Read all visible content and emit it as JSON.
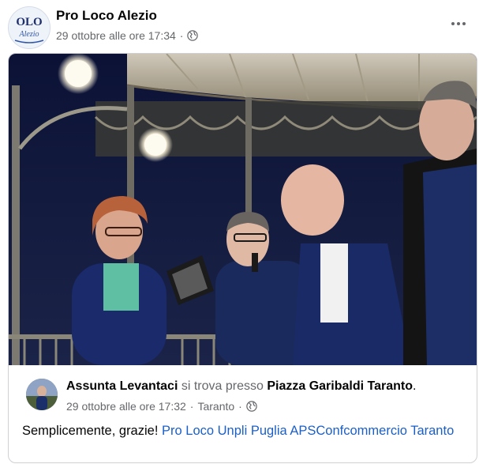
{
  "page": {
    "name": "Pro Loco Alezio",
    "timestamp": "29 ottobre alle ore 17:34",
    "separator": "·",
    "avatar_text": "OLO",
    "avatar_script": "Alezio",
    "privacy_icon": "globe-icon",
    "more_icon": "more-options-icon"
  },
  "shared_post": {
    "author": "Assunta Levantaci",
    "location_prefix": "si trova presso",
    "location": "Piazza Garibaldi Taranto",
    "location_suffix": ".",
    "timestamp": "29 ottobre alle ore 17:32",
    "separator": "·",
    "place": "Taranto",
    "caption_text": "Semplicemente, grazie!",
    "tag_1": "Pro Loco Unpli Puglia APS",
    "tag_2": "Confcommercio Taranto"
  },
  "colors": {
    "link": "#1b5fc7",
    "secondary_text": "#65676b",
    "border": "#ced0d4"
  }
}
